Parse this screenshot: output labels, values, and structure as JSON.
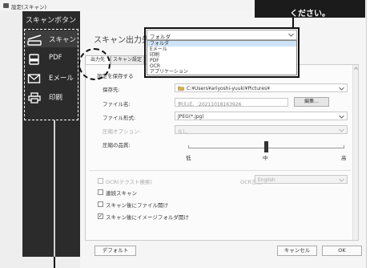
{
  "window": {
    "title": "設定(スキャン)"
  },
  "callout": {
    "text": "ください。"
  },
  "sidebar": {
    "title": "スキャンボタン",
    "items": [
      {
        "label": "スキャン",
        "icon": "scanner-icon",
        "selected": true
      },
      {
        "label": "PDF",
        "icon": "pdf-icon",
        "selected": false
      },
      {
        "label": "Eメール",
        "icon": "mail-icon",
        "selected": false
      },
      {
        "label": "印刷",
        "icon": "printer-icon",
        "selected": false
      }
    ]
  },
  "output": {
    "label": "スキャン出力先:",
    "selected": "フォルダ",
    "options": [
      "フォルダ",
      "Eメール",
      "印刷",
      "PDF",
      "OCR",
      "アプリケーション"
    ]
  },
  "tabs": [
    {
      "label": "出力先",
      "active": true
    },
    {
      "label": "スキャン設定",
      "active": false
    },
    {
      "label": "イ",
      "active": false
    }
  ],
  "settings": {
    "save_section": "設定を保存する",
    "save_to": {
      "label": "保存先:",
      "value": "C:¥Users¥ariyoshi-yuuki¥Pictures¥"
    },
    "file_name": {
      "label": "ファイル名:",
      "value": "例えば、:20211018163926",
      "edit_button": "編集..."
    },
    "file_format": {
      "label": "ファイル形式:",
      "value": "JPEG(*.jpg)"
    },
    "compression": {
      "label": "圧縮オプション:",
      "value": "なし"
    },
    "quality": {
      "label": "圧縮の品質:",
      "low": "低",
      "mid": "中",
      "high": "高",
      "level": 0.5
    }
  },
  "options": {
    "ocr": {
      "label": "OCR(テクスト検索)",
      "checked": false,
      "lang_label": "OCR言語",
      "lang_value": "English"
    },
    "continuous": {
      "label": "連続スキャン",
      "checked": false
    },
    "open_file": {
      "label": "スキャン後にファイル開け",
      "checked": false
    },
    "open_folder": {
      "label": "スキャン後にイメージフォルダ開け",
      "checked": true
    }
  },
  "buttons": {
    "default": "デフォルト",
    "cancel": "キャンセル",
    "ok": "OK"
  },
  "colors": {
    "sidebar_bg": "#2b2b2b",
    "selection": "#cfe3f7",
    "annotation": "#111111"
  }
}
